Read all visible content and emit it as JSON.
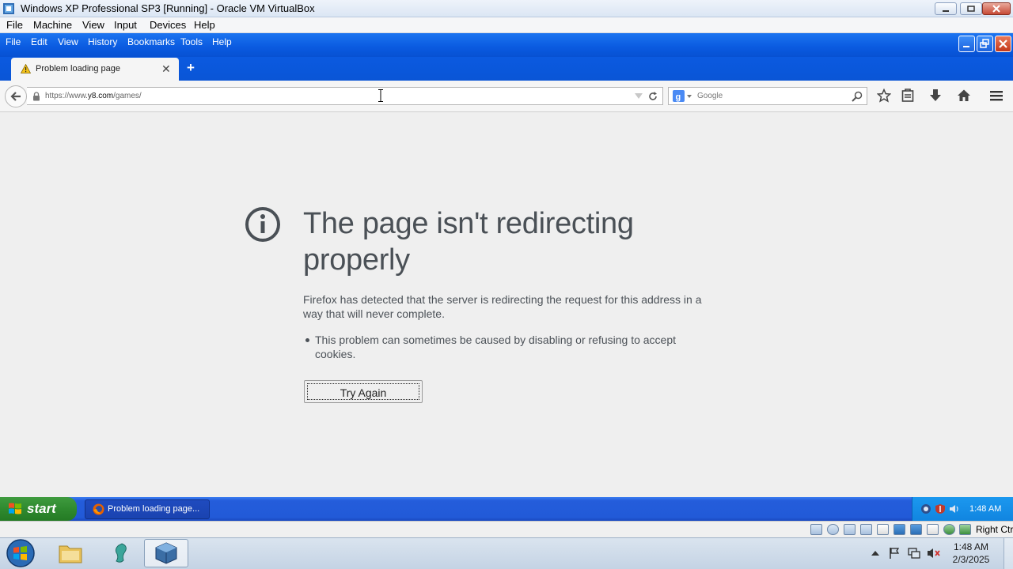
{
  "host_window": {
    "title": "Windows XP Professional SP3 [Running] - Oracle VM VirtualBox",
    "menu": [
      "File",
      "Machine",
      "View",
      "Input",
      "Devices",
      "Help"
    ]
  },
  "firefox": {
    "menu": [
      "File",
      "Edit",
      "View",
      "History",
      "Bookmarks",
      "Tools",
      "Help"
    ],
    "tab": {
      "title": "Problem loading page"
    },
    "url": {
      "prefix": "https://www.",
      "domain": "y8.com",
      "path": "/games/"
    },
    "search": {
      "placeholder": "Google"
    }
  },
  "error_page": {
    "title": "The page isn't redirecting properly",
    "description": "Firefox has detected that the server is redirecting the request for this address in a way that will never complete.",
    "bullet": "This problem can sometimes be caused by disabling or refusing to accept cookies.",
    "try_again": "Try Again"
  },
  "xp_taskbar": {
    "start_label": "start",
    "task_label": "Problem loading page...",
    "clock": "1:48 AM"
  },
  "vbox_status": {
    "host_key": "Right Ctrl"
  },
  "host_taskbar": {
    "time": "1:48 AM",
    "date": "2/3/2025"
  },
  "colors": {
    "xp_blue": "#0a5ae0",
    "start_green": "#2f8a2f",
    "page_bg": "#efefef",
    "error_text": "#4a5056"
  }
}
